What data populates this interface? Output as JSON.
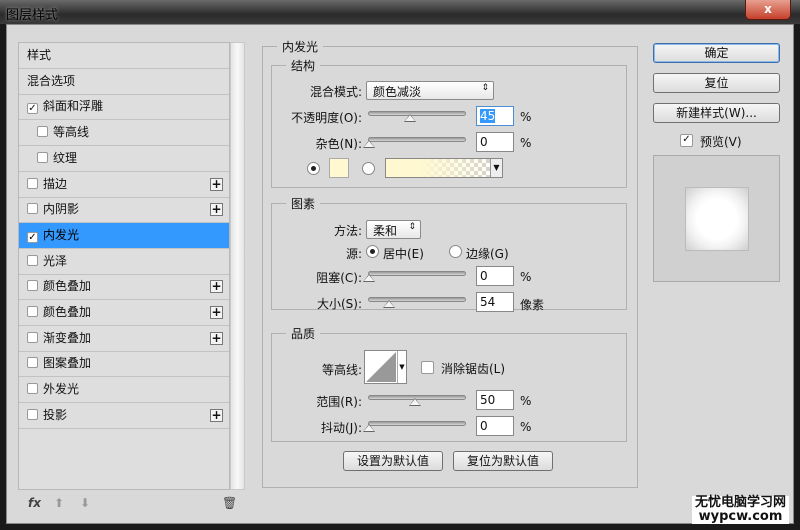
{
  "window": {
    "title": "图层样式",
    "close_label": "x"
  },
  "sidebar": {
    "items": [
      {
        "label": "样式",
        "checkbox": null,
        "plus": false,
        "indent": false
      },
      {
        "label": "混合选项",
        "checkbox": null,
        "plus": false,
        "indent": false
      },
      {
        "label": "斜面和浮雕",
        "checkbox": true,
        "plus": false,
        "indent": false
      },
      {
        "label": "等高线",
        "checkbox": false,
        "plus": false,
        "indent": true
      },
      {
        "label": "纹理",
        "checkbox": false,
        "plus": false,
        "indent": true
      },
      {
        "label": "描边",
        "checkbox": false,
        "plus": true,
        "indent": false
      },
      {
        "label": "内阴影",
        "checkbox": false,
        "plus": true,
        "indent": false
      },
      {
        "label": "内发光",
        "checkbox": true,
        "plus": false,
        "indent": false,
        "selected": true
      },
      {
        "label": "光泽",
        "checkbox": false,
        "plus": false,
        "indent": false
      },
      {
        "label": "颜色叠加",
        "checkbox": false,
        "plus": true,
        "indent": false
      },
      {
        "label": "颜色叠加",
        "checkbox": false,
        "plus": true,
        "indent": false
      },
      {
        "label": "渐变叠加",
        "checkbox": false,
        "plus": true,
        "indent": false
      },
      {
        "label": "图案叠加",
        "checkbox": false,
        "plus": false,
        "indent": false
      },
      {
        "label": "外发光",
        "checkbox": false,
        "plus": false,
        "indent": false
      },
      {
        "label": "投影",
        "checkbox": false,
        "plus": true,
        "indent": false
      }
    ],
    "toolbar": {
      "fx": "fx",
      "up": "⬆",
      "down": "⬇",
      "trash": "🗑"
    }
  },
  "panel": {
    "title": "内发光",
    "structure": {
      "title": "结构",
      "blend_label": "混合模式:",
      "blend_value": "颜色减淡",
      "opacity_label": "不透明度(O):",
      "opacity": "45",
      "opacity_unit": "%",
      "noise_label": "杂色(N):",
      "noise": "0",
      "noise_unit": "%",
      "color": "#fff8d0"
    },
    "elements": {
      "title": "图素",
      "method_label": "方法:",
      "method_value": "柔和",
      "source_label": "源:",
      "center_label": "居中(E)",
      "edge_label": "边缘(G)",
      "choke_label": "阻塞(C):",
      "choke": "0",
      "choke_unit": "%",
      "size_label": "大小(S):",
      "size": "54",
      "size_unit": "像素"
    },
    "quality": {
      "title": "品质",
      "contour_label": "等高线:",
      "antialias_label": "消除锯齿(L)",
      "range_label": "范围(R):",
      "range": "50",
      "range_unit": "%",
      "jitter_label": "抖动(J):",
      "jitter": "0",
      "jitter_unit": "%"
    },
    "set_default": "设置为默认值",
    "reset_default": "复位为默认值"
  },
  "right": {
    "ok": "确定",
    "reset": "复位",
    "new_style": "新建样式(W)...",
    "preview_label": "预览(V)",
    "preview_checked": true
  },
  "watermark": {
    "line1": "无忧电脑学习网",
    "line2": "wypcw.com"
  },
  "colors": {
    "selection": "#3399ff",
    "dialog_bg": "#d9d9d9"
  }
}
